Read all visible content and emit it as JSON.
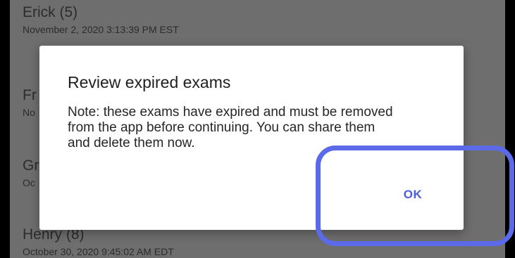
{
  "exam_list": {
    "items": [
      {
        "name": "Erick (5)",
        "date": "November 2, 2020 3:13:39 PM EST"
      },
      {
        "name": "Fr",
        "date": "No"
      },
      {
        "name": "Gr",
        "date": "Oc"
      },
      {
        "name": "Henry (8)",
        "date": "October 30, 2020 9:45:02 AM EDT"
      }
    ]
  },
  "dialog": {
    "title": "Review expired exams",
    "body": "Note: these exams have expired and must be removed from the app before continuing. You can share them and delete them now.",
    "ok_label": "OK"
  },
  "colors": {
    "accent": "#4a5ed6",
    "highlight_ring": "#5a6ae8",
    "scrim_background": "#6e6e6e"
  }
}
